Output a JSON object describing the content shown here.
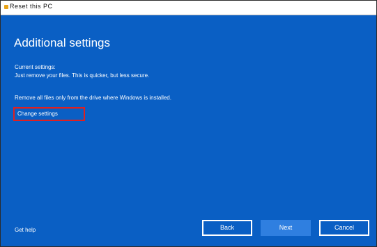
{
  "window": {
    "title": "Reset this PC"
  },
  "page": {
    "heading": "Additional settings",
    "settings": [
      "Current settings:",
      "Just remove your files. This is quicker, but less secure.",
      "Remove all files only from the drive where Windows is installed."
    ],
    "change_link": "Change settings",
    "help_link": "Get help"
  },
  "buttons": {
    "back": "Back",
    "next": "Next",
    "cancel": "Cancel"
  },
  "colors": {
    "background": "#0a5fc4",
    "next_button": "#2f7fe0",
    "highlight_box": "#e02020"
  }
}
